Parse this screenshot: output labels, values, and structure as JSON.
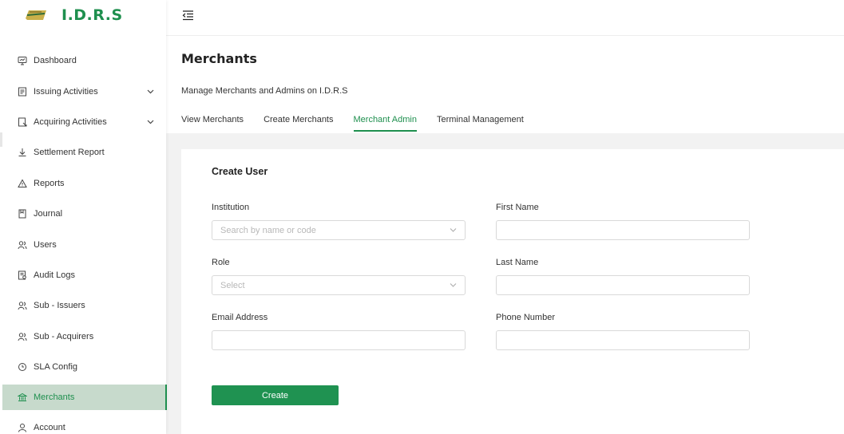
{
  "brand": {
    "title": "I.D.R.S"
  },
  "sidebar": {
    "items": [
      {
        "label": "Dashboard",
        "icon": "dashboard-icon"
      },
      {
        "label": "Issuing Activities",
        "icon": "issuing-icon",
        "expandable": true
      },
      {
        "label": "Acquiring Activities",
        "icon": "acquiring-icon",
        "expandable": true
      },
      {
        "label": "Settlement Report",
        "icon": "download-icon"
      },
      {
        "label": "Reports",
        "icon": "warning-icon"
      },
      {
        "label": "Journal",
        "icon": "journal-icon"
      },
      {
        "label": "Users",
        "icon": "users-icon"
      },
      {
        "label": "Audit Logs",
        "icon": "audit-icon"
      },
      {
        "label": "Sub - Issuers",
        "icon": "users-icon"
      },
      {
        "label": "Sub - Acquirers",
        "icon": "users-icon"
      },
      {
        "label": "SLA Config",
        "icon": "clock-icon"
      },
      {
        "label": "Merchants",
        "icon": "bank-icon",
        "active": true
      },
      {
        "label": "Account",
        "icon": "account-icon"
      }
    ]
  },
  "page": {
    "title": "Merchants",
    "subtitle": "Manage Merchants and Admins on I.D.R.S",
    "tabs": [
      {
        "label": "View Merchants"
      },
      {
        "label": "Create Merchants"
      },
      {
        "label": "Merchant Admin",
        "active": true
      },
      {
        "label": "Terminal Management"
      }
    ]
  },
  "form": {
    "title": "Create User",
    "institution": {
      "label": "Institution",
      "placeholder": "Search by name or code"
    },
    "first_name": {
      "label": "First Name",
      "value": ""
    },
    "role": {
      "label": "Role",
      "placeholder": "Select"
    },
    "last_name": {
      "label": "Last Name",
      "value": ""
    },
    "email": {
      "label": "Email Address",
      "value": ""
    },
    "phone": {
      "label": "Phone Number",
      "value": ""
    },
    "submit_label": "Create"
  },
  "colors": {
    "accent": "#1e8f4e",
    "active_bg": "#c7dacc",
    "content_bg": "#f2f2f2"
  }
}
